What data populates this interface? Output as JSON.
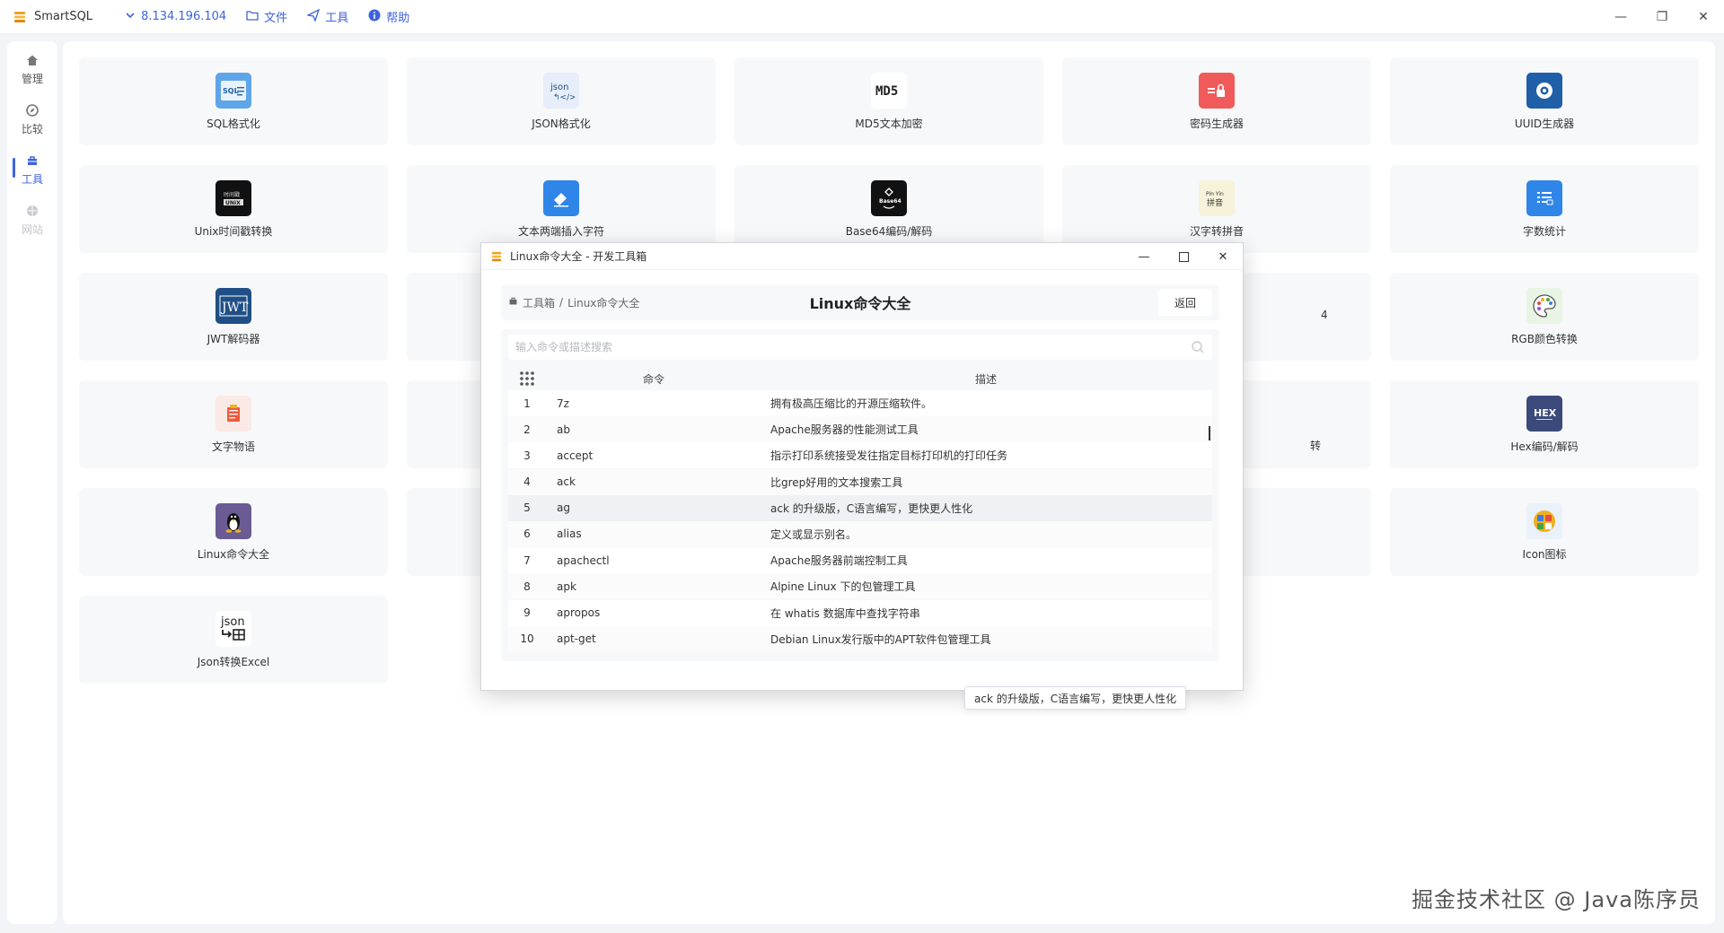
{
  "window": {
    "app_name": "SmartSQL",
    "controls": {
      "minimize": "—",
      "restore": "❐",
      "close": "✕"
    }
  },
  "menu": {
    "connection": "8.134.196.104",
    "file": "文件",
    "tools": "工具",
    "help": "帮助"
  },
  "sidebar": {
    "items": [
      {
        "label": "管理",
        "icon": "home-icon"
      },
      {
        "label": "比较",
        "icon": "compare-icon"
      },
      {
        "label": "工具",
        "icon": "toolbox-icon"
      },
      {
        "label": "网站",
        "icon": "web-icon"
      }
    ]
  },
  "tiles": [
    {
      "label": "SQL格式化",
      "icon": "sql-format-icon",
      "color": "#5fa6e8"
    },
    {
      "label": "JSON格式化",
      "icon": "json-format-icon",
      "color": "#e7eef9"
    },
    {
      "label": "MD5文本加密",
      "icon": "md5-icon",
      "color": "#ffffff"
    },
    {
      "label": "密码生成器",
      "icon": "password-icon",
      "color": "#f05a5a"
    },
    {
      "label": "UUID生成器",
      "icon": "uuid-icon",
      "color": "#1f5fa8"
    },
    {
      "label": "Unix时间戳转换",
      "icon": "unix-icon",
      "color": "#111111"
    },
    {
      "label": "文本两端插入字符",
      "icon": "eraser-icon",
      "color": "#2f86e8"
    },
    {
      "label": "Base64编码/解码",
      "icon": "base64-icon",
      "color": "#111111"
    },
    {
      "label": "汉字转拼音",
      "icon": "pinyin-icon",
      "color": "#f6f3da"
    },
    {
      "label": "字数统计",
      "icon": "word-count-icon",
      "color": "#2f86e8"
    },
    {
      "label": "JWT解码器",
      "icon": "jwt-icon",
      "color": "#1f4f86"
    },
    {
      "label": "RGB颜色转换",
      "icon": "palette-icon",
      "color": "#e8f4e4"
    },
    {
      "label": "文字物语",
      "icon": "text-story-icon",
      "color": "#fbe9e5"
    },
    {
      "label": "Hex编码/解码",
      "icon": "hex-icon",
      "color": "#3b4a7a"
    },
    {
      "label": "Linux命令大全",
      "icon": "linux-icon",
      "color": "#6b5b95"
    },
    {
      "label": "Icon图标",
      "icon": "icon-library-icon",
      "color": "#eaf1fb"
    },
    {
      "label": "Json转换Excel",
      "icon": "json-excel-icon",
      "color": "#ffffff"
    }
  ],
  "behind_fragments": {
    "row3": "4",
    "row4": "转"
  },
  "dialog": {
    "title": "Linux命令大全 - 开发工具箱",
    "breadcrumb_root": "工具箱",
    "breadcrumb_sep": "/",
    "breadcrumb_current": "Linux命令大全",
    "page_title": "Linux命令大全",
    "back_label": "返回",
    "search_placeholder": "输入命令或描述搜索",
    "col_command": "命令",
    "col_description": "描述",
    "rows": [
      {
        "n": "1",
        "cmd": "7z",
        "desc": "拥有极高压缩比的开源压缩软件。"
      },
      {
        "n": "2",
        "cmd": "ab",
        "desc": "Apache服务器的性能测试工具"
      },
      {
        "n": "3",
        "cmd": "accept",
        "desc": "指示打印系统接受发往指定目标打印机的打印任务"
      },
      {
        "n": "4",
        "cmd": "ack",
        "desc": "比grep好用的文本搜索工具"
      },
      {
        "n": "5",
        "cmd": "ag",
        "desc": "ack 的升级版，C语言编写，更快更人性化"
      },
      {
        "n": "6",
        "cmd": "alias",
        "desc": "定义或显示别名。"
      },
      {
        "n": "7",
        "cmd": "apachectl",
        "desc": "Apache服务器前端控制工具"
      },
      {
        "n": "8",
        "cmd": "apk",
        "desc": "Alpine Linux 下的包管理工具"
      },
      {
        "n": "9",
        "cmd": "apropos",
        "desc": "在 whatis 数据库中查找字符串"
      },
      {
        "n": "10",
        "cmd": "apt-get",
        "desc": "Debian Linux发行版中的APT软件包管理工具"
      }
    ],
    "tooltip": "ack 的升级版，C语言编写，更快更人性化"
  },
  "watermark": "掘金技术社区 @ Java陈序员",
  "colors": {
    "accent": "#3d63dd"
  }
}
